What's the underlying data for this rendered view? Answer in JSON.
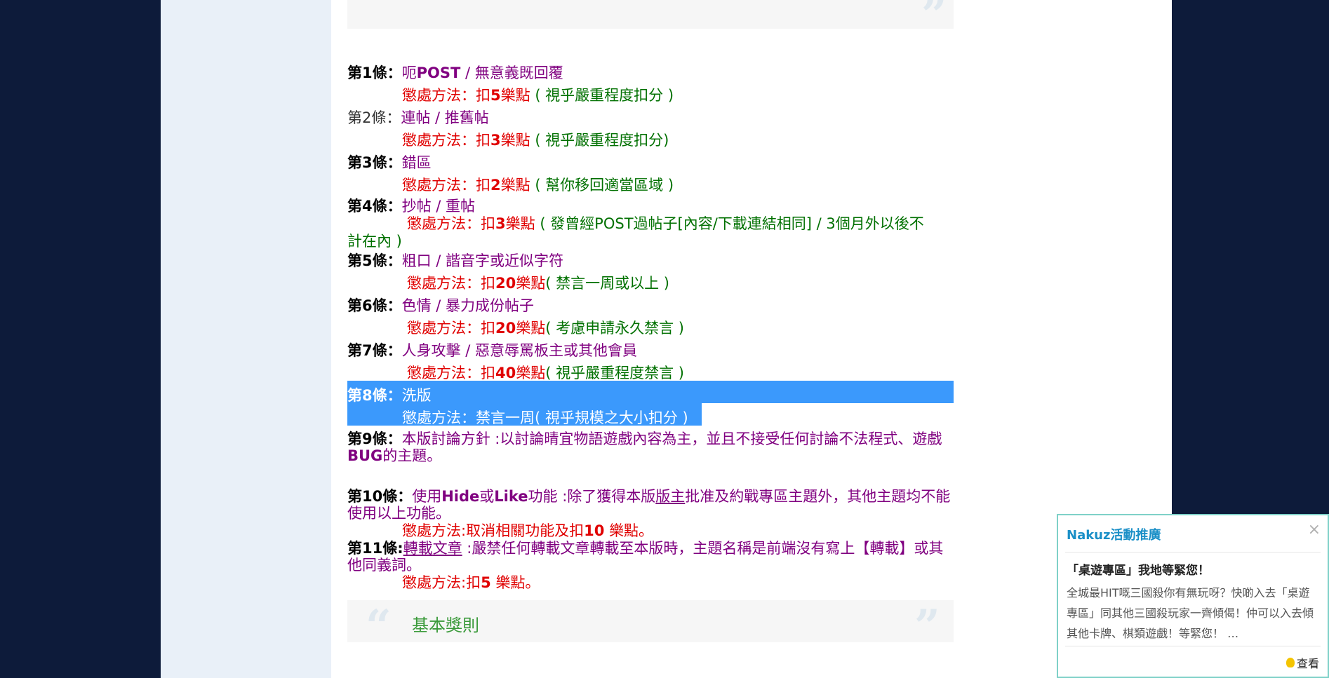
{
  "rules": [
    {
      "num": "第1條：",
      "title_parts": [
        "呃",
        "POST",
        " / 無意義既回覆"
      ],
      "penalty_label": "懲處方法：扣",
      "penalty_points": "5",
      "penalty_unit": "樂點",
      "penalty_note": "( 視乎嚴重程度扣分 )"
    },
    {
      "num": "第2條：",
      "title": "連帖 / 推舊帖",
      "penalty_label": "懲處方法：扣",
      "penalty_points": "3",
      "penalty_unit": "樂點",
      "penalty_note": "( 視乎嚴重程度扣分)"
    },
    {
      "num": "第3條：",
      "title": "錯區",
      "penalty_label": "懲處方法：扣",
      "penalty_points": "2",
      "penalty_unit": "樂點",
      "penalty_note": "( 幫你移回適當區域 )"
    },
    {
      "num": "第4條：",
      "title": "抄帖 / 重帖",
      "penalty_label": "懲處方法：扣",
      "penalty_points": "3",
      "penalty_unit": "樂點",
      "penalty_note_line1": "( 發曾經POST過帖子[內容/下載連結相同] / 3個月外以後不",
      "penalty_note_line2": "計在內 )"
    },
    {
      "num": "第5條：",
      "title": "粗口 / 諧音字或近似字符",
      "penalty_label": "懲處方法：扣",
      "penalty_points": "20",
      "penalty_unit": "樂點",
      "penalty_note": "( 禁言一周或以上 )"
    },
    {
      "num": "第6條：",
      "title": "色情 / 暴力成份帖子",
      "penalty_label": "懲處方法：扣",
      "penalty_points": "20",
      "penalty_unit": "樂點",
      "penalty_note": "( 考慮申請永久禁言 )"
    },
    {
      "num": "第7條：",
      "title": "人身攻擊 / 惡意辱罵板主或其他會員",
      "penalty_label": "懲處方法：扣",
      "penalty_points": "40",
      "penalty_unit": "樂點",
      "penalty_note": "( 視乎嚴重程度禁言 )"
    },
    {
      "num": "第8條：",
      "title": "洗版",
      "penalty_label": "懲處方法：禁言一周",
      "penalty_note": "( 視乎規模之大小扣分 )"
    },
    {
      "num": "第9條：",
      "text_line1": "本版討論方針 :以討論晴宜物語遊戲內容為主，並且不接受任何討論不法程式、遊戲",
      "text_line2_bold": "BUG",
      "text_line2": "的主題。"
    },
    {
      "num": "第10條：",
      "text_a": "使用",
      "text_hide": "Hide",
      "text_or": "或",
      "text_like": "Like",
      "text_b": "功能 :除了獲得本版",
      "text_link": "版主",
      "text_c": "批准及約戰專區主題外，其他主題均不能",
      "text_line2": "使用以上功能。",
      "penalty": "懲處方法:取消相關功能及扣",
      "penalty_points": "10",
      "penalty_tail": " 樂點。"
    },
    {
      "num": "第11條:",
      "link1": "轉載",
      "link2": "文章",
      "text_a": " :嚴禁任何轉載文章轉載至本版時，主題名稱是前端沒有寫上【轉載】或其",
      "text_line2": "他同義詞。",
      "penalty": "懲處方法:扣",
      "penalty_points": "5",
      "penalty_tail": " 樂點。"
    }
  ],
  "section_heading": "基本獎則",
  "popup": {
    "header": "Nakuz活動推廣",
    "close": "×",
    "title": "「桌遊專區」我地等緊您！",
    "body": "全城最HIT嘅三國殺你有無玩呀？快啲入去「桌遊專區」同其他三國殺玩家一齊傾偈！仲可以入去傾其他卡牌、棋類遊戲！等緊您！ …",
    "view": "查看"
  },
  "colors": {
    "background": "#0d1b3a",
    "rule_title": "#800080",
    "penalty": "#e00000",
    "note": "#007000",
    "selection": "#3b99fc",
    "popup_header": "#1a8fc7"
  }
}
